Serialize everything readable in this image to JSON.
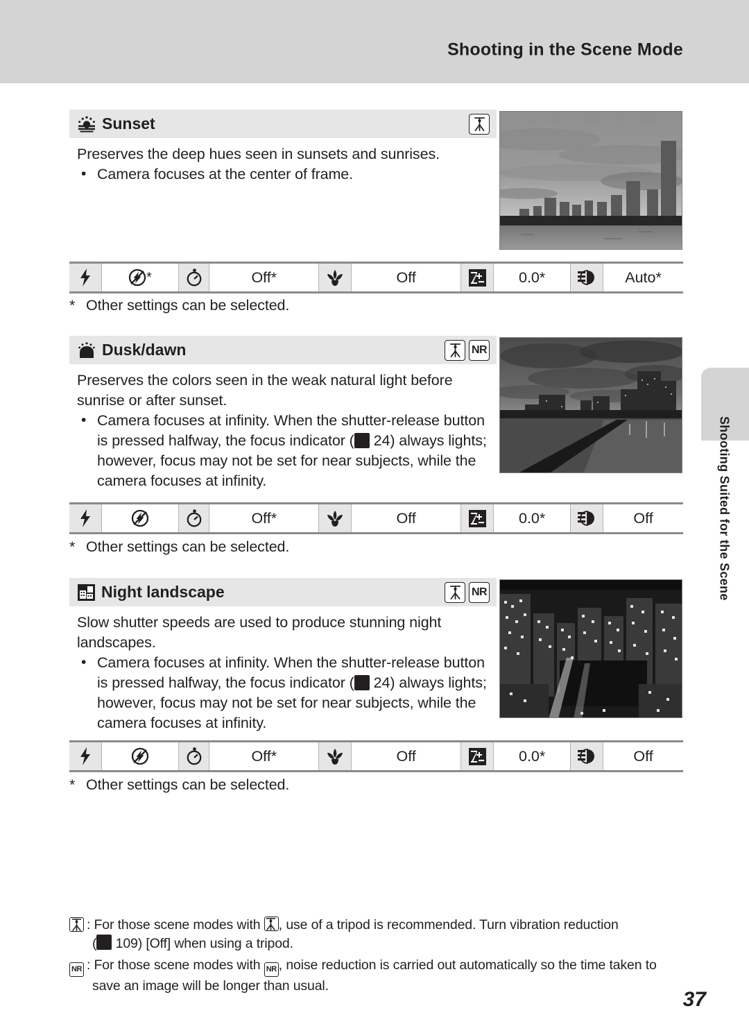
{
  "header": {
    "title": "Shooting in the Scene Mode"
  },
  "side_tab": {
    "label": "Shooting Suited for the Scene"
  },
  "page_number": "37",
  "scenes": [
    {
      "icon": "sunset-icon",
      "name": "Sunset",
      "badges": [
        "tripod",
        "none"
      ],
      "description": "Preserves the deep hues seen in sunsets and sunrises.",
      "bullets": [
        "Camera focuses at the center of frame."
      ],
      "photo_alt": "sunset-city-skyline-photo",
      "settings": {
        "flash_icon": "flash-icon",
        "flash_value_icon": "flash-off-icon",
        "flash_value": "*",
        "timer_icon": "self-timer-icon",
        "timer_value": "Off*",
        "macro_icon": "macro-icon",
        "macro_value": "Off",
        "exposure_icon": "exposure-compensation-icon",
        "exposure_value": "0.0*",
        "whitebalance_icon": "image-brightness-icon",
        "whitebalance_value": "Auto*"
      },
      "footnote": "Other settings can be selected.",
      "footnote_marker": "*"
    },
    {
      "icon": "dusk-dawn-icon",
      "name": "Dusk/dawn",
      "badges": [
        "tripod",
        "nr"
      ],
      "description": "Preserves the colors seen in the weak natural light before sunrise or after sunset.",
      "bullets": [
        "Camera focuses at infinity. When the shutter-release button is pressed halfway, the focus indicator ( 24) always lights; however, focus may not be set for near subjects, while the camera focuses at infinity."
      ],
      "bullet_lines": [
        "Camera focuses at infinity. When the shutter-release button",
        "is pressed halfway, the focus indicator (",
        "24) always lights;",
        "however, focus may not be set for near subjects, while the",
        "camera focuses at infinity."
      ],
      "photo_alt": "dusk-dawn-waterfront-photo",
      "settings": {
        "flash_icon": "flash-icon",
        "flash_value_icon": "flash-off-icon",
        "flash_value": "",
        "timer_icon": "self-timer-icon",
        "timer_value": "Off*",
        "macro_icon": "macro-icon",
        "macro_value": "Off",
        "exposure_icon": "exposure-compensation-icon",
        "exposure_value": "0.0*",
        "whitebalance_icon": "image-brightness-icon",
        "whitebalance_value": "Off"
      },
      "footnote": "Other settings can be selected.",
      "footnote_marker": "*"
    },
    {
      "icon": "night-landscape-icon",
      "name": "Night landscape",
      "badges": [
        "tripod",
        "nr"
      ],
      "description": "Slow shutter speeds are used to produce stunning night landscapes.",
      "bullet_lines": [
        "Camera focuses at infinity. When the shutter-release button",
        "is pressed halfway, the focus indicator (",
        "24) always lights;",
        "however, focus may not be set for near subjects, while the",
        "camera focuses at infinity."
      ],
      "photo_alt": "night-landscape-city-photo",
      "settings": {
        "flash_icon": "flash-icon",
        "flash_value_icon": "flash-off-icon",
        "flash_value": "",
        "timer_icon": "self-timer-icon",
        "timer_value": "Off*",
        "macro_icon": "macro-icon",
        "macro_value": "Off",
        "exposure_icon": "exposure-compensation-icon",
        "exposure_value": "0.0*",
        "whitebalance_icon": "image-brightness-icon",
        "whitebalance_value": "Off"
      },
      "footnote": "Other settings can be selected.",
      "footnote_marker": "*"
    }
  ],
  "footer": {
    "tripod_note": {
      "key_icon": "tripod-icon",
      "line1_a": ": For those scene modes with ",
      "line1_b": ", use of a tripod is recommended. Turn vibration reduction",
      "line2_a": "(",
      "line2_b": "109) [Off] when using a tripod."
    },
    "nr_note": {
      "key_icon": "nr-icon",
      "line1_a": ": For those scene modes with ",
      "line1_b": ", noise reduction is carried out automatically so the time taken to",
      "line2": "save an image will be longer than usual."
    }
  },
  "colors": {
    "header_bg": "#d4d4d4",
    "scene_head_bg": "#e6e6e6",
    "rule": "#8a8a8a",
    "text": "#231f20"
  }
}
